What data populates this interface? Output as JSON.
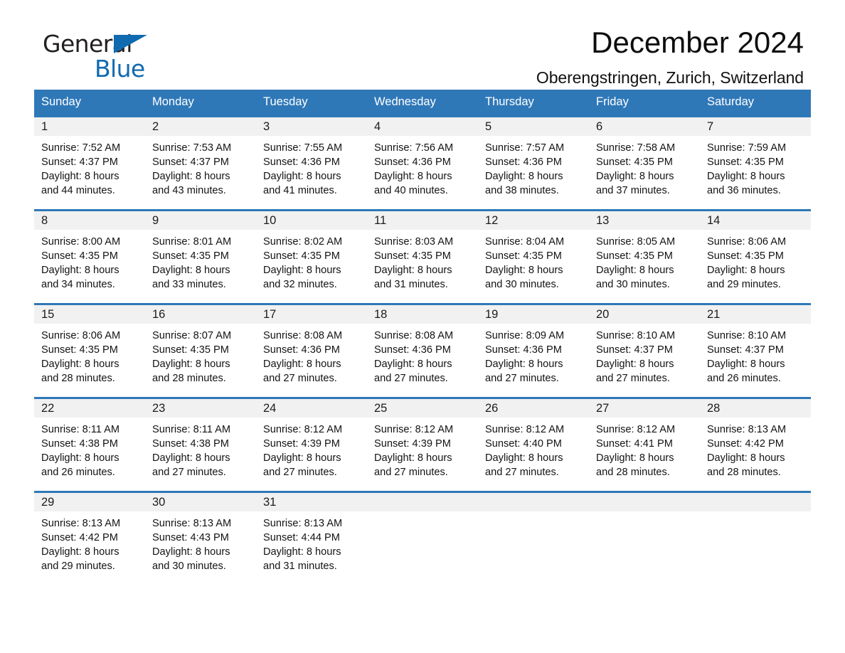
{
  "brand": {
    "line1": "General",
    "line2": "Blue",
    "triangle_icon": "blue-triangle-logo-mark"
  },
  "header": {
    "title": "December 2024",
    "subtitle": "Oberengstringen, Zurich, Switzerland"
  },
  "colors": {
    "header_blue": "#2f78b8",
    "brand_blue": "#0f6ab0",
    "daynum_band": "#f1f1f1",
    "text": "#131313"
  },
  "calendar": {
    "weekday_headers": [
      "Sunday",
      "Monday",
      "Tuesday",
      "Wednesday",
      "Thursday",
      "Friday",
      "Saturday"
    ],
    "weeks": [
      [
        {
          "day": "1",
          "info": "Sunrise: 7:52 AM\nSunset: 4:37 PM\nDaylight: 8 hours\nand 44 minutes."
        },
        {
          "day": "2",
          "info": "Sunrise: 7:53 AM\nSunset: 4:37 PM\nDaylight: 8 hours\nand 43 minutes."
        },
        {
          "day": "3",
          "info": "Sunrise: 7:55 AM\nSunset: 4:36 PM\nDaylight: 8 hours\nand 41 minutes."
        },
        {
          "day": "4",
          "info": "Sunrise: 7:56 AM\nSunset: 4:36 PM\nDaylight: 8 hours\nand 40 minutes."
        },
        {
          "day": "5",
          "info": "Sunrise: 7:57 AM\nSunset: 4:36 PM\nDaylight: 8 hours\nand 38 minutes."
        },
        {
          "day": "6",
          "info": "Sunrise: 7:58 AM\nSunset: 4:35 PM\nDaylight: 8 hours\nand 37 minutes."
        },
        {
          "day": "7",
          "info": "Sunrise: 7:59 AM\nSunset: 4:35 PM\nDaylight: 8 hours\nand 36 minutes."
        }
      ],
      [
        {
          "day": "8",
          "info": "Sunrise: 8:00 AM\nSunset: 4:35 PM\nDaylight: 8 hours\nand 34 minutes."
        },
        {
          "day": "9",
          "info": "Sunrise: 8:01 AM\nSunset: 4:35 PM\nDaylight: 8 hours\nand 33 minutes."
        },
        {
          "day": "10",
          "info": "Sunrise: 8:02 AM\nSunset: 4:35 PM\nDaylight: 8 hours\nand 32 minutes."
        },
        {
          "day": "11",
          "info": "Sunrise: 8:03 AM\nSunset: 4:35 PM\nDaylight: 8 hours\nand 31 minutes."
        },
        {
          "day": "12",
          "info": "Sunrise: 8:04 AM\nSunset: 4:35 PM\nDaylight: 8 hours\nand 30 minutes."
        },
        {
          "day": "13",
          "info": "Sunrise: 8:05 AM\nSunset: 4:35 PM\nDaylight: 8 hours\nand 30 minutes."
        },
        {
          "day": "14",
          "info": "Sunrise: 8:06 AM\nSunset: 4:35 PM\nDaylight: 8 hours\nand 29 minutes."
        }
      ],
      [
        {
          "day": "15",
          "info": "Sunrise: 8:06 AM\nSunset: 4:35 PM\nDaylight: 8 hours\nand 28 minutes."
        },
        {
          "day": "16",
          "info": "Sunrise: 8:07 AM\nSunset: 4:35 PM\nDaylight: 8 hours\nand 28 minutes."
        },
        {
          "day": "17",
          "info": "Sunrise: 8:08 AM\nSunset: 4:36 PM\nDaylight: 8 hours\nand 27 minutes."
        },
        {
          "day": "18",
          "info": "Sunrise: 8:08 AM\nSunset: 4:36 PM\nDaylight: 8 hours\nand 27 minutes."
        },
        {
          "day": "19",
          "info": "Sunrise: 8:09 AM\nSunset: 4:36 PM\nDaylight: 8 hours\nand 27 minutes."
        },
        {
          "day": "20",
          "info": "Sunrise: 8:10 AM\nSunset: 4:37 PM\nDaylight: 8 hours\nand 27 minutes."
        },
        {
          "day": "21",
          "info": "Sunrise: 8:10 AM\nSunset: 4:37 PM\nDaylight: 8 hours\nand 26 minutes."
        }
      ],
      [
        {
          "day": "22",
          "info": "Sunrise: 8:11 AM\nSunset: 4:38 PM\nDaylight: 8 hours\nand 26 minutes."
        },
        {
          "day": "23",
          "info": "Sunrise: 8:11 AM\nSunset: 4:38 PM\nDaylight: 8 hours\nand 27 minutes."
        },
        {
          "day": "24",
          "info": "Sunrise: 8:12 AM\nSunset: 4:39 PM\nDaylight: 8 hours\nand 27 minutes."
        },
        {
          "day": "25",
          "info": "Sunrise: 8:12 AM\nSunset: 4:39 PM\nDaylight: 8 hours\nand 27 minutes."
        },
        {
          "day": "26",
          "info": "Sunrise: 8:12 AM\nSunset: 4:40 PM\nDaylight: 8 hours\nand 27 minutes."
        },
        {
          "day": "27",
          "info": "Sunrise: 8:12 AM\nSunset: 4:41 PM\nDaylight: 8 hours\nand 28 minutes."
        },
        {
          "day": "28",
          "info": "Sunrise: 8:13 AM\nSunset: 4:42 PM\nDaylight: 8 hours\nand 28 minutes."
        }
      ],
      [
        {
          "day": "29",
          "info": "Sunrise: 8:13 AM\nSunset: 4:42 PM\nDaylight: 8 hours\nand 29 minutes."
        },
        {
          "day": "30",
          "info": "Sunrise: 8:13 AM\nSunset: 4:43 PM\nDaylight: 8 hours\nand 30 minutes."
        },
        {
          "day": "31",
          "info": "Sunrise: 8:13 AM\nSunset: 4:44 PM\nDaylight: 8 hours\nand 31 minutes."
        },
        {
          "day": "",
          "info": ""
        },
        {
          "day": "",
          "info": ""
        },
        {
          "day": "",
          "info": ""
        },
        {
          "day": "",
          "info": ""
        }
      ]
    ]
  }
}
